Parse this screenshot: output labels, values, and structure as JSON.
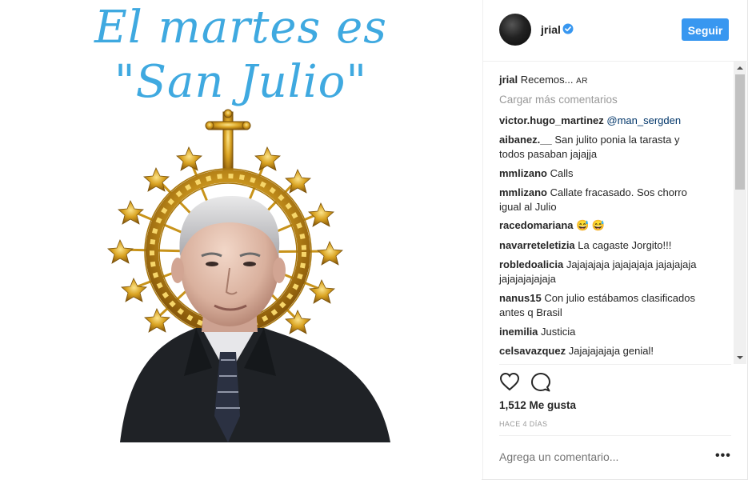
{
  "post": {
    "caption_line1": "El martes es",
    "caption_line2": "\"San Julio\""
  },
  "header": {
    "username": "jrial",
    "follow_label": "Seguir"
  },
  "comments": {
    "owner_username": "jrial",
    "owner_text": "Recemos...",
    "owner_flag": "AR",
    "load_more": "Cargar más comentarios",
    "items": [
      {
        "user": "victor.hugo_martinez",
        "text": "@man_sergden"
      },
      {
        "user": "aibanez.__",
        "text": "San julito ponia la tarasta y todos pasaban jajajja"
      },
      {
        "user": "mmlizano",
        "text": "Calls"
      },
      {
        "user": "mmlizano",
        "text": "Callate fracasado. Sos chorro igual al Julio"
      },
      {
        "user": "racedomariana",
        "text": "😅 😅"
      },
      {
        "user": "navarreteletizia",
        "text": "La cagaste Jorgito!!!"
      },
      {
        "user": "robledoalicia",
        "text": "Jajajajaja jajajajaja jajajajaja jajajajajajaja"
      },
      {
        "user": "nanus15",
        "text": "Con julio estábamos clasificados antes q Brasil"
      },
      {
        "user": "inemilia",
        "text": "Justicia"
      },
      {
        "user": "celsavazquez",
        "text": "Jajajajajaja genial!"
      }
    ]
  },
  "actions": {
    "likes": "1,512 Me gusta",
    "time_ago": "HACE 4 DÍAS",
    "comment_placeholder": "Agrega un comentario...",
    "more_label": "•••"
  },
  "colors": {
    "caption": "#3fa9e0",
    "follow_button": "#3897f0",
    "verified": "#3897f0",
    "halo_gold": "#d4a017"
  },
  "icons": [
    "verified-badge-icon",
    "heart-icon",
    "comment-icon",
    "more-options-icon",
    "scroll-up-icon",
    "scroll-down-icon"
  ]
}
